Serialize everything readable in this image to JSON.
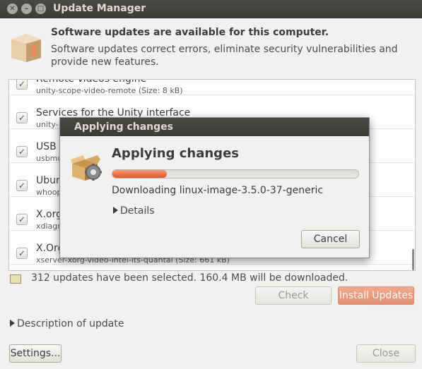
{
  "window": {
    "title": "Update Manager"
  },
  "header": {
    "title": "Software updates are available for this computer.",
    "subtitle": "Software updates correct errors, eliminate security vulnerabilities and provide new features."
  },
  "updates": [
    {
      "name": "Remote videos engine",
      "package": "unity-scope-video-remote (Size: 8 kB)"
    },
    {
      "name": "Services for the Unity interface",
      "package": "unity-"
    },
    {
      "name": "USB m",
      "package": "usbmu"
    },
    {
      "name": "Ubun",
      "package": "whoop"
    },
    {
      "name": "X.org",
      "package": "xdiagr"
    },
    {
      "name": "X.Org",
      "package": "xserver-xorg-video-intel-lts-quantal (Size: 661 kB)"
    }
  ],
  "status": "312 updates have been selected. 160.4 MB will be downloaded.",
  "buttons": {
    "check": "Check",
    "install": "Install Updates",
    "settings": "Settings...",
    "close": "Close"
  },
  "description_expander": "Description of update",
  "dialog": {
    "window_title": "Applying changes",
    "heading": "Applying changes",
    "progress_fraction": 0.22,
    "status": "Downloading linux-image-3.5.0-37-generic",
    "details_label": "Details",
    "cancel": "Cancel"
  },
  "colors": {
    "titlebar": "#3d3c38",
    "accent_orange": "#e36d46",
    "progress": "#e2552a"
  }
}
